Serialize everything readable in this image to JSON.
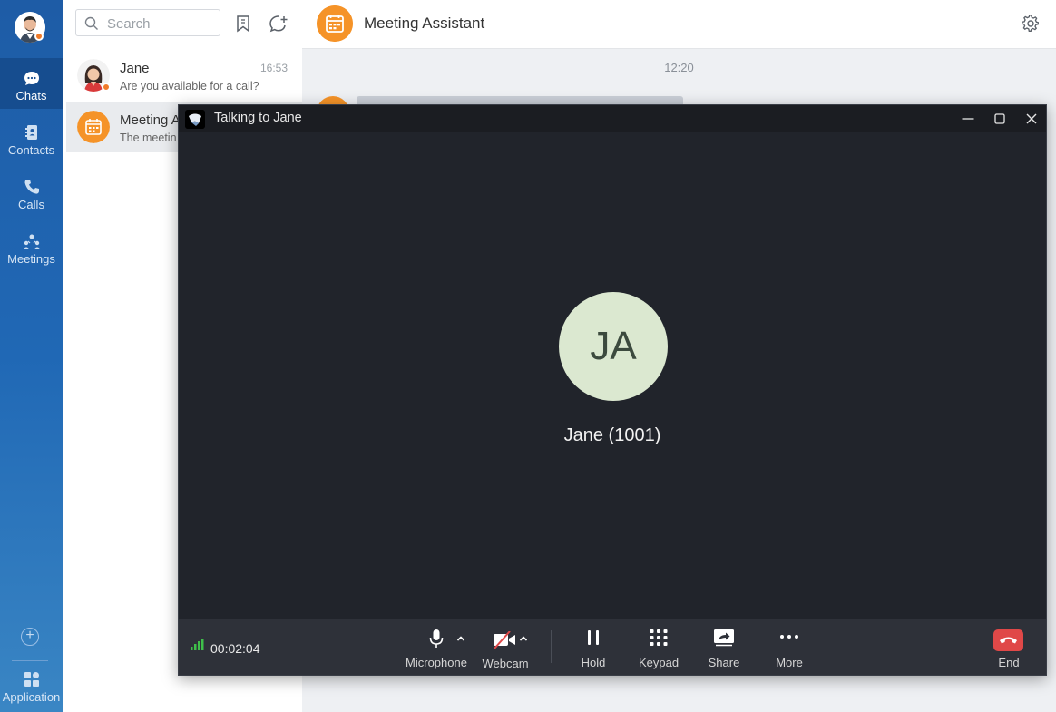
{
  "nav": {
    "items": [
      {
        "label": "Chats",
        "icon": "chat-bubble-icon",
        "active": true
      },
      {
        "label": "Contacts",
        "icon": "contacts-book-icon"
      },
      {
        "label": "Calls",
        "icon": "phone-icon"
      },
      {
        "label": "Meetings",
        "icon": "people-icon"
      }
    ],
    "application_label": "Application"
  },
  "chat_list": {
    "search_placeholder": "Search",
    "chats": [
      {
        "name": "Jane",
        "preview": "Are you available for a call?",
        "time": "16:53"
      },
      {
        "name": "Meeting A",
        "preview": "The meetin",
        "time": ""
      }
    ]
  },
  "conversation": {
    "title": "Meeting Assistant",
    "timestamp": "12:20"
  },
  "call": {
    "window_title": "Talking to Jane",
    "initials": "JA",
    "caller_name": "Jane (1001)",
    "duration": "00:02:04",
    "controls": {
      "microphone": "Microphone",
      "webcam": "Webcam",
      "hold": "Hold",
      "keypad": "Keypad",
      "share": "Share",
      "more": "More",
      "end": "End"
    },
    "colors": {
      "end": "#e04848",
      "signal": "#3fbf4a",
      "avatar_bg": "#dbe8d0"
    }
  }
}
